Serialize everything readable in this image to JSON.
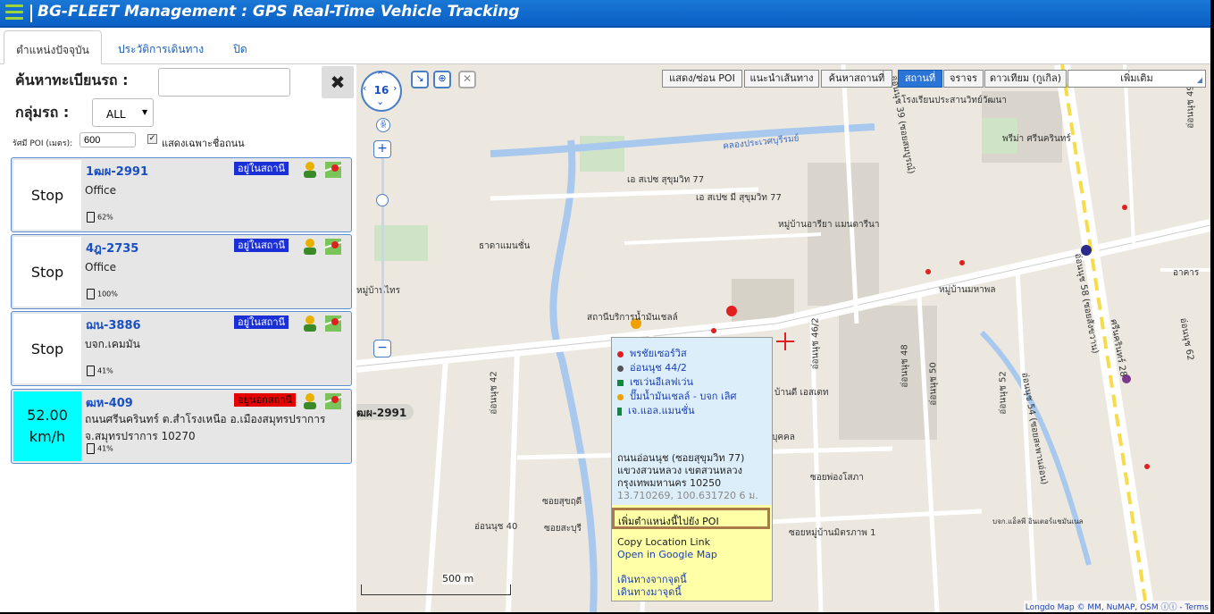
{
  "header": {
    "title": "BG-FLEET Management : GPS Real-Time Vehicle Tracking"
  },
  "tabs": [
    {
      "label": "ตำแหน่งปัจจุบัน"
    },
    {
      "label": "ประวัติการเดินทาง"
    },
    {
      "label": "ปิด"
    }
  ],
  "search": {
    "plate_label": "ค้นหาทะเบียนรถ :",
    "plate_value": "",
    "group_label": "กลุ่มรถ :",
    "group_value": "ALL",
    "poi_radius_label": "รัศมี POI (เมตร):",
    "poi_radius_value": "600",
    "road_only_label": "แสดงเฉพาะชื่อถนน",
    "road_only_checked": true
  },
  "vehicles": [
    {
      "speed": "Stop",
      "plate": "1ฒผ-2991",
      "status": "อยู่ในสถานี",
      "location": "Office",
      "fuel": "62%"
    },
    {
      "speed": "Stop",
      "plate": "4ฎ-2735",
      "status": "อยู่ในสถานี",
      "location": "Office",
      "fuel": "100%"
    },
    {
      "speed": "Stop",
      "plate": "ฌน-3886",
      "status": "อยู่ในสถานี",
      "location": "บจก.เคมมัน",
      "fuel": "41%"
    },
    {
      "speed": "52.00 km/h",
      "speed_value": "52.00",
      "speed_unit": "km/h",
      "plate": "ฒห-409",
      "status": "อยู่นอกสถานี",
      "location": "ถนนศรีนครินทร์ ต.สำโรงเหนือ อ.เมืองสมุทรปราการ จ.สมุทรปราการ 10270",
      "fuel": "41%"
    }
  ],
  "map": {
    "zoom": "16",
    "buttons": [
      "แสดง/ซ่อน POI",
      "แนะนำเส้นทาง",
      "ค้นหาสถานที่"
    ],
    "layers": [
      "สถานที่",
      "จราจร",
      "ดาวเทียม (กูเกิล)"
    ],
    "active_layer": "สถานที่",
    "more_select": "เพิ่มเติม",
    "vehicle_label": "ฒผ-2991",
    "scale": "500 m",
    "credit": "Longdo Map © MM, NuMAP, OSM ⓘⓘ - Terms",
    "labels": [
      "คลองประเวศบุรีรมย์",
      "โรงเรียนประสานวิทย์วัฒนา",
      "เอ สเปซ สุขุมวิท 77",
      "เอ สเปซ มี สุขุมวิท 77",
      "หมู่บ้านอารียา แมนดารีนา",
      "ธาดาแมนชั่น",
      "สถานีบริการน้ำมันเชลล์",
      "หมู่บ้านมหาพล",
      "ซอยพ่องโสภา",
      "ซอยสุขฤดี",
      "ซอยสะบุรี",
      "ซอยหมู่บ้านมิตรภาพ 1",
      "อ่อนนุช 40",
      "อ่อนนุช 42",
      "อ่อนนุช 46/2",
      "อ่อนนุช 48",
      "อ่อนนุช 50",
      "อ่อนนุช 52",
      "อ่อนนุช 54 (ซอยสะพานอ่อน)",
      "อ่อนนุช 58 (ซอยสังขวาน)",
      "ศรีนครินทร์ 28",
      "อ่อนนุช 62",
      "อ่อนนุช 39 (ซอยสมบูรณ์)",
      "อ่อนนุช 49",
      "บจก.แอ็ลพี อินเตอร์แชมันเนล",
      "อาคาร",
      "พรีม่า ศรีนครินทร์",
      "หมู่บ้านไทร",
      "บุคคล",
      "บ้านดี เอสเตท"
    ]
  },
  "popup": {
    "pois": [
      {
        "name": "พรชัยเซอร์วิส",
        "color": "#e02020"
      },
      {
        "name": "อ่อนนุช 44/2",
        "color": "#555555"
      },
      {
        "name": "เซเว่นอีเลฟเว่น",
        "color": "#0a8a3a"
      },
      {
        "name": "ปั๊มน้ำมันเชลล์ - บจก เลิศ",
        "color": "#f0a000"
      },
      {
        "name": "เจ.แอล.แมนชั่น",
        "color": "#0a8a3a"
      }
    ],
    "address_lines": [
      "ถนนอ่อนนุช (ซอยสุขุมวิท 77)",
      "แขวงสวนหลวง เขตสวนหลวง",
      "กรุงเทพมหานคร 10250"
    ],
    "coordinates": "13.710269, 100.631720 6 ม.",
    "add_poi": "เพิ่มตำแหน่งนี้ไปยัง POI",
    "copy_link": "Copy Location Link",
    "open_google": "Open in Google Map",
    "route_from": "เดินทางจากจุดนี้",
    "route_to": "เดินทางมาจุดนี้"
  },
  "colors": {
    "header": "#0a5fc4",
    "moving": "#00ffff",
    "in_station": "#1a2fd6",
    "out_station": "#e60000"
  }
}
